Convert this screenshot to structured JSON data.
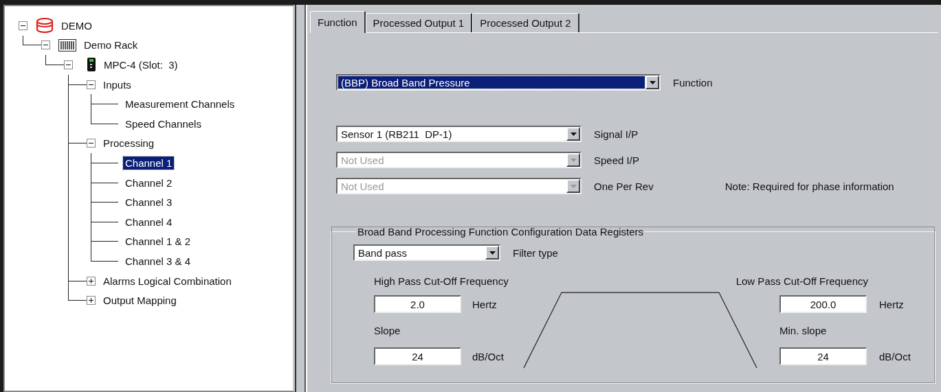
{
  "tree": [
    {
      "label": "DEMO",
      "kind": "database",
      "expanded": true,
      "selected": false,
      "children": [
        {
          "label": "Demo Rack",
          "kind": "rack",
          "expanded": true,
          "selected": false,
          "children": [
            {
              "label": "MPC-4 (Slot:  3)",
              "kind": "module",
              "expanded": true,
              "selected": false,
              "children": [
                {
                  "label": "Inputs",
                  "expanded": true,
                  "selected": false,
                  "children": [
                    {
                      "label": "Measurement Channels",
                      "selected": false
                    },
                    {
                      "label": "Speed Channels",
                      "selected": false
                    }
                  ]
                },
                {
                  "label": "Processing",
                  "expanded": true,
                  "selected": false,
                  "children": [
                    {
                      "label": "Channel 1",
                      "selected": true
                    },
                    {
                      "label": "Channel 2",
                      "selected": false
                    },
                    {
                      "label": "Channel 3",
                      "selected": false
                    },
                    {
                      "label": "Channel 4",
                      "selected": false
                    },
                    {
                      "label": "Channel 1 & 2",
                      "selected": false
                    },
                    {
                      "label": "Channel 3 & 4",
                      "selected": false
                    }
                  ]
                },
                {
                  "label": "Alarms Logical Combination",
                  "expanded": false,
                  "selected": false
                },
                {
                  "label": "Output Mapping",
                  "expanded": false,
                  "selected": false
                }
              ]
            }
          ]
        }
      ]
    }
  ],
  "tabs": [
    {
      "label": "Function",
      "selected": true
    },
    {
      "label": "Processed Output 1",
      "selected": false
    },
    {
      "label": "Processed Output 2",
      "selected": false
    }
  ],
  "function_select": {
    "value": "(BBP) Broad Band Pressure",
    "label": "Function",
    "highlighted": true
  },
  "inputs": [
    {
      "value": "Sensor 1 (RB211  DP-1)",
      "label": "Signal I/P",
      "disabled": false
    },
    {
      "value": "Not Used",
      "label": "Speed I/P",
      "disabled": true
    },
    {
      "value": "Not Used",
      "label": "One Per Rev",
      "disabled": true,
      "note": "Note: Required for phase information"
    }
  ],
  "group": {
    "title": "Broad Band Processing Function Configuration Data Registers",
    "filter": {
      "value": "Band pass",
      "label": "Filter type"
    },
    "high_pass": {
      "title": "High Pass Cut-Off Frequency",
      "value": "2.0",
      "unit": "Hertz",
      "slope_label": "Slope",
      "slope_value": "24",
      "slope_unit": "dB/Oct"
    },
    "low_pass": {
      "title": "Low Pass Cut-Off Frequency",
      "value": "200.0",
      "unit": "Hertz",
      "slope_label": "Min. slope",
      "slope_value": "24",
      "slope_unit": "dB/Oct"
    }
  }
}
